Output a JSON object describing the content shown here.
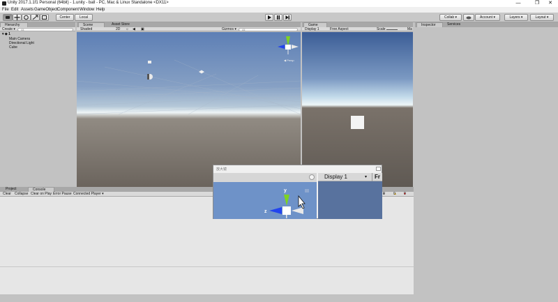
{
  "window": {
    "title": "Unity 2017.1.1f1 Personal (64bit) - 1.unity - ball - PC, Mac & Linux Standalone <DX11>",
    "minimize": "—",
    "maximize": "❐",
    "close": "✕"
  },
  "menu": [
    "File",
    "Edit",
    "Assets",
    "GameObject",
    "Component",
    "Window",
    "Help"
  ],
  "toolbar": {
    "pivot": "Center",
    "space": "Local",
    "collab": "Collab ▾",
    "account": "Account ▾",
    "layers": "Layers",
    "layout": "Layout"
  },
  "hierarchy": {
    "tab": "Hierarchy",
    "create": "Create ▾",
    "search_placeholder": "All",
    "scene_name": "1",
    "items": [
      "Main Camera",
      "Directional Light",
      "Cube"
    ]
  },
  "scene": {
    "tabs": [
      "Scene",
      "Asset Store"
    ],
    "shading": "Shaded",
    "mode2d": "2D",
    "gizmos": "Gizmos ▾",
    "search_placeholder": "All"
  },
  "game": {
    "tab": "Game",
    "display": "Display 1",
    "aspect": "Free Aspect",
    "scale": "Scale",
    "maximize": "Ma"
  },
  "inspector": {
    "tabs": [
      "Inspector",
      "Services"
    ]
  },
  "console": {
    "tabs": [
      "Project",
      "Console"
    ],
    "buttons": [
      "Clear",
      "Collapse",
      "Clear on Play",
      "Error Pause",
      "Connected Player ▾"
    ],
    "counts": [
      "0",
      "0",
      "0"
    ]
  },
  "magnifier": {
    "title": "放大镜",
    "display": "Display 1",
    "fr_label": "Fr",
    "axis_y": "y",
    "axis_z": "z"
  },
  "colors": {
    "scene_sky": "#86a0c4",
    "game_sky": "#3b5d96",
    "axis_y": "#7ed321",
    "axis_z": "#2244ee"
  }
}
